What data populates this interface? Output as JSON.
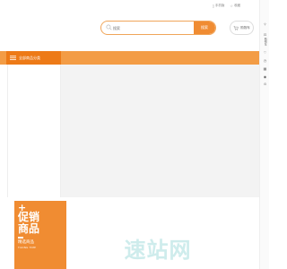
{
  "top_links": [
    {
      "icon": "phone-icon",
      "label": "手机版"
    },
    {
      "icon": "star-icon",
      "label": "收藏"
    }
  ],
  "search": {
    "placeholder": "搜索",
    "button_label": "搜索"
  },
  "cart": {
    "label": "购物车"
  },
  "nav": {
    "all_categories": "全部商品分类"
  },
  "right_sidebar": [
    {
      "icon": "user-icon",
      "label": ""
    },
    {
      "icon": "cart-icon",
      "label": "购物车"
    },
    {
      "icon": "heart-icon",
      "label": ""
    },
    {
      "icon": "clock-icon",
      "label": ""
    },
    {
      "icon": "qr-icon",
      "label": ""
    },
    {
      "icon": "chat-icon",
      "label": ""
    },
    {
      "icon": "back-top-icon",
      "label": ""
    }
  ],
  "promo": {
    "plus": "+",
    "title": "促销商品",
    "subtitle": "精选商品",
    "english": "TAKING TIME"
  },
  "watermark": {
    "text": "速站网"
  },
  "colors": {
    "accent": "#f08c32",
    "nav_bar": "#f39c45",
    "nav_category": "#ed7a17"
  }
}
